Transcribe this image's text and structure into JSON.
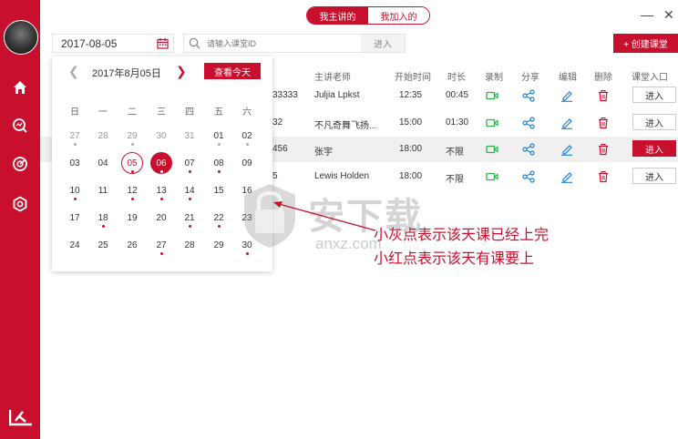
{
  "tabs": {
    "mine": "我主讲的",
    "joined": "我加入的"
  },
  "window": {
    "minimize": "—",
    "close": "✕"
  },
  "date_value": "2017-08-05",
  "search": {
    "placeholder": "请输入课堂ID",
    "join_label": "进入"
  },
  "create_label": "+ 创建课堂",
  "columns": [
    "主讲老师",
    "开始时间",
    "时长",
    "录制",
    "分享",
    "编辑",
    "删除",
    "课堂入口"
  ],
  "rows": [
    {
      "id": "33333",
      "teacher": "Juljia Lpkst",
      "start": "12:35",
      "duration": "00:45",
      "enter": "进入",
      "highlight": false
    },
    {
      "id": "32",
      "teacher": "不凡奇舞飞扬...",
      "start": "15:00",
      "duration": "01:30",
      "enter": "进入",
      "highlight": false
    },
    {
      "id": "456",
      "teacher": "张宇",
      "start": "18:00",
      "duration": "不限",
      "enter": "进入",
      "highlight": true
    },
    {
      "id": "5",
      "teacher": "Lewis Holden",
      "start": "18:00",
      "duration": "不限",
      "enter": "进入",
      "highlight": false
    }
  ],
  "calendar": {
    "title": "2017年8月05日",
    "today_label": "查看今天",
    "weekdays": [
      "日",
      "一",
      "二",
      "三",
      "四",
      "五",
      "六"
    ],
    "weeks": [
      [
        {
          "d": "27",
          "grey": true,
          "dot": "grey"
        },
        {
          "d": "28",
          "grey": true
        },
        {
          "d": "29",
          "grey": true,
          "dot": "grey"
        },
        {
          "d": "30",
          "grey": true
        },
        {
          "d": "31",
          "grey": true
        },
        {
          "d": "01",
          "dot": "grey"
        },
        {
          "d": "02",
          "dot": "grey"
        }
      ],
      [
        {
          "d": "03"
        },
        {
          "d": "04"
        },
        {
          "d": "05",
          "sel": true,
          "dot": "red"
        },
        {
          "d": "06",
          "today": true,
          "dot": "white"
        },
        {
          "d": "07",
          "dot": "red"
        },
        {
          "d": "08",
          "dot": "red"
        },
        {
          "d": "09"
        }
      ],
      [
        {
          "d": "10",
          "dot": "red"
        },
        {
          "d": "11"
        },
        {
          "d": "12",
          "dot": "red"
        },
        {
          "d": "13",
          "dot": "red"
        },
        {
          "d": "14",
          "dot": "red"
        },
        {
          "d": "15"
        },
        {
          "d": "16"
        }
      ],
      [
        {
          "d": "17"
        },
        {
          "d": "18",
          "dot": "red"
        },
        {
          "d": "19"
        },
        {
          "d": "20"
        },
        {
          "d": "21",
          "dot": "red"
        },
        {
          "d": "22",
          "dot": "red"
        },
        {
          "d": "23"
        }
      ],
      [
        {
          "d": "24"
        },
        {
          "d": "25"
        },
        {
          "d": "26"
        },
        {
          "d": "27",
          "dot": "red"
        },
        {
          "d": "28"
        },
        {
          "d": "29"
        },
        {
          "d": "30",
          "dot": "red"
        }
      ]
    ]
  },
  "annotations": {
    "line1": "小灰点表示该天课已经上完",
    "line2": "小红点表示该天有课要上"
  },
  "watermark": {
    "text": "安下载",
    "sub": "anxz.com"
  },
  "colors": {
    "accent": "#c8102e",
    "green": "#2bb34a",
    "blue": "#1e7fd6"
  }
}
